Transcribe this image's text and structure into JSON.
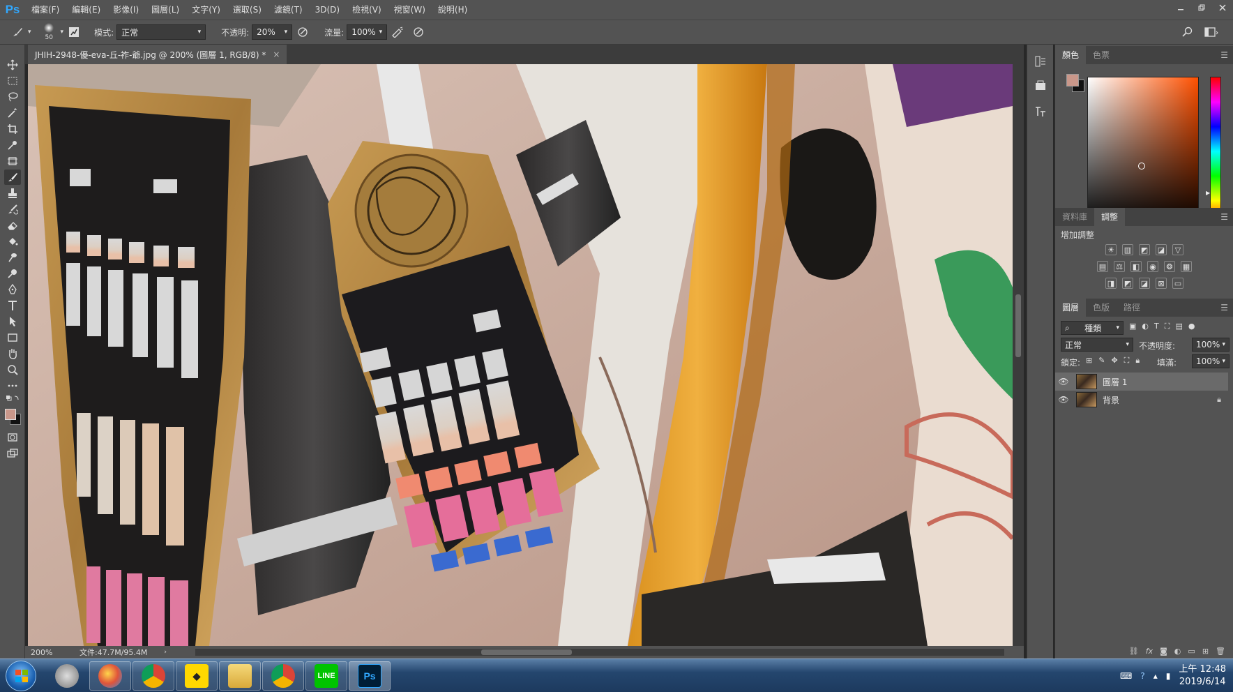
{
  "app": {
    "logo": "Ps"
  },
  "menu": [
    "檔案(F)",
    "編輯(E)",
    "影像(I)",
    "圖層(L)",
    "文字(Y)",
    "選取(S)",
    "濾鏡(T)",
    "3D(D)",
    "檢視(V)",
    "視窗(W)",
    "說明(H)"
  ],
  "options": {
    "brush_size": "50",
    "mode_label": "模式:",
    "mode_value": "正常",
    "opacity_label": "不透明:",
    "opacity_value": "20%",
    "flow_label": "流量:",
    "flow_value": "100%"
  },
  "document": {
    "tab_title": "JHIH-2948-優-eva-丘-祚-爺.jpg @ 200% (圖層 1, RGB/8) *",
    "close": "×",
    "zoom": "200%",
    "file_info": "文件:47.7M/95.4M"
  },
  "panels": {
    "color_tabs": [
      "顏色",
      "色票"
    ],
    "adjust_tabs": [
      "資料庫",
      "調整"
    ],
    "adjust_title": "增加調整",
    "layer_tabs": [
      "圖層",
      "色版",
      "路徑"
    ],
    "kind_filter": "種類",
    "blend_mode": "正常",
    "opacity_label": "不透明度:",
    "opacity_value": "100%",
    "lock_label": "鎖定:",
    "fill_label": "填滿:",
    "fill_value": "100%",
    "layers": [
      {
        "name": "圖層 1",
        "selected": true,
        "locked": false
      },
      {
        "name": "背景",
        "selected": false,
        "locked": true
      }
    ]
  },
  "colors": {
    "foreground": "#c9978a",
    "background": "#111111",
    "accent": "#31a8ff"
  },
  "taskbar": {
    "apps": [
      "speaker",
      "paint",
      "chrome",
      "kakao",
      "explorer",
      "chrome",
      "line",
      "photoshop"
    ],
    "line_label": "LINE",
    "ps_label": "Ps",
    "time": "上午 12:48",
    "date": "2019/6/14"
  }
}
